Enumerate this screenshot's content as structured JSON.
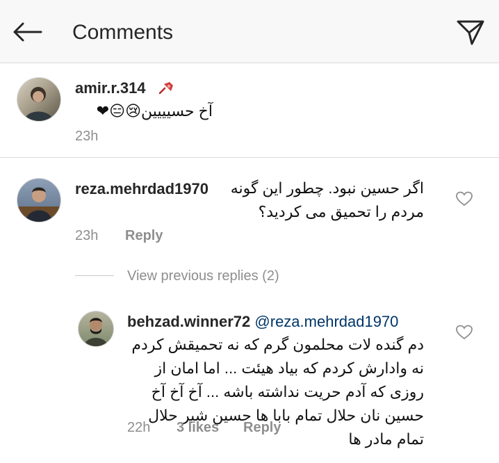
{
  "header": {
    "title": "Comments"
  },
  "pinned_comment": {
    "username": "amir.r.314",
    "text": "آخ حسیییین😢😑❤",
    "time": "23h"
  },
  "comment": {
    "username": "reza.mehrdad1970",
    "text": "اگر حسین نبود. چطور این گونه مردم را تحمیق می کردید؟",
    "time": "23h",
    "reply_label": "Reply"
  },
  "view_previous": {
    "label": "View previous replies (2)"
  },
  "reply": {
    "username": "behzad.winner72",
    "mention": "@reza.mehrdad1970",
    "text": "دم گنده لات محلمون گرم که نه تحمیقش کردم نه وادارش کردم که بیاد هیئت ... اما امان از روزی که آدم حریت نداشته باشه ... آخ آخ آخ حسین نان حلال تمام بابا ها حسین شیر حلال تمام مادر ها",
    "time": "22h",
    "likes": "3 likes",
    "reply_label": "Reply"
  },
  "colors": {
    "text": "#262626",
    "meta": "#8e8e8e",
    "mention": "#003569",
    "topbar": "#f8f8f8",
    "divider": "#dbdbdb"
  }
}
